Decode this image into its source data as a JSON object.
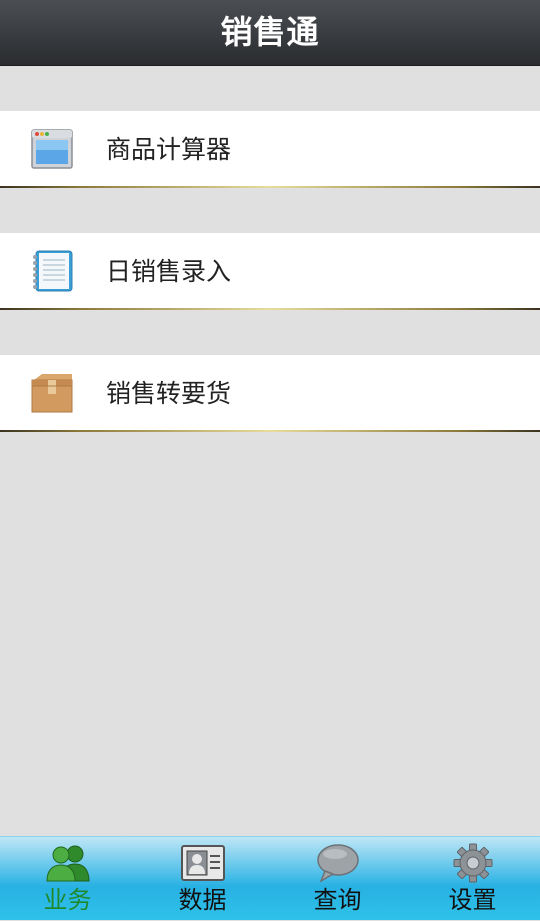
{
  "header": {
    "title": "销售通"
  },
  "menu": {
    "items": [
      {
        "label": "商品计算器",
        "icon": "calculator-window-icon"
      },
      {
        "label": "日销售录入",
        "icon": "notebook-icon"
      },
      {
        "label": "销售转要货",
        "icon": "package-box-icon"
      }
    ]
  },
  "tabbar": {
    "active_index": 0,
    "active_color": "#1f8a2d",
    "tabs": [
      {
        "label": "业务",
        "icon": "users-icon"
      },
      {
        "label": "数据",
        "icon": "contact-card-icon"
      },
      {
        "label": "查询",
        "icon": "chat-bubble-icon"
      },
      {
        "label": "设置",
        "icon": "gear-icon"
      }
    ]
  }
}
